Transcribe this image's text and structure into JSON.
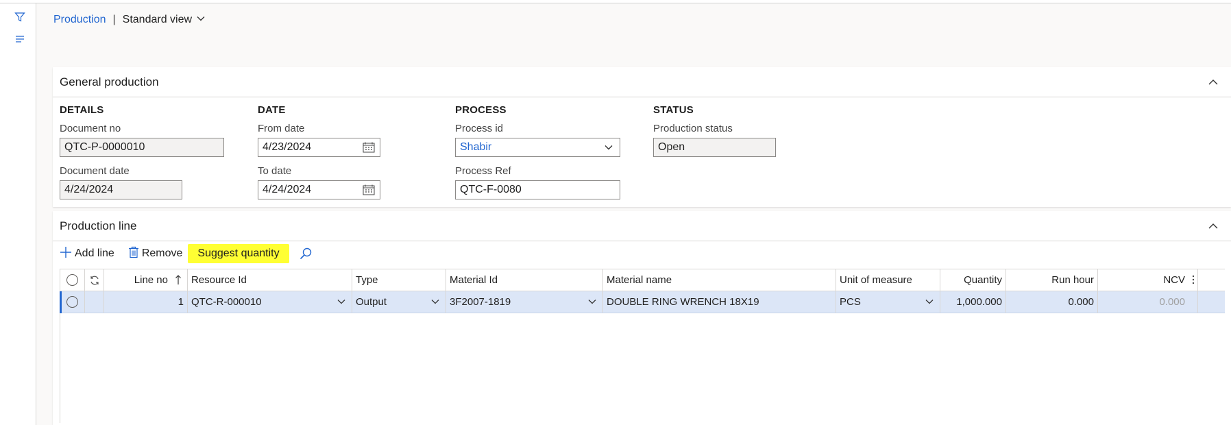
{
  "breadcrumb": {
    "module": "Production",
    "separator": "|",
    "view": "Standard view"
  },
  "general": {
    "title": "General production",
    "details": {
      "heading": "DETAILS",
      "document_no_label": "Document no",
      "document_no": "QTC-P-0000010",
      "document_date_label": "Document date",
      "document_date": "4/24/2024"
    },
    "date": {
      "heading": "DATE",
      "from_label": "From date",
      "from": "4/23/2024",
      "to_label": "To date",
      "to": "4/24/2024"
    },
    "process": {
      "heading": "PROCESS",
      "process_id_label": "Process id",
      "process_id": "Shabir",
      "process_ref_label": "Process Ref",
      "process_ref": "QTC-F-0080"
    },
    "status": {
      "heading": "STATUS",
      "production_status_label": "Production status",
      "production_status": "Open"
    }
  },
  "lines": {
    "title": "Production line",
    "toolbar": {
      "add_line": "Add line",
      "remove": "Remove",
      "suggest_quantity": "Suggest quantity"
    },
    "columns": {
      "line_no": "Line no",
      "resource_id": "Resource Id",
      "type": "Type",
      "material_id": "Material Id",
      "material_name": "Material name",
      "unit": "Unit of measure",
      "quantity": "Quantity",
      "run_hour": "Run hour",
      "ncv": "NCV"
    },
    "rows": [
      {
        "line_no": "1",
        "resource_id": "QTC-R-000010",
        "type": "Output",
        "material_id": "3F2007-1819",
        "material_name": "DOUBLE RING WRENCH 18X19",
        "unit": "PCS",
        "quantity": "1,000.000",
        "run_hour": "0.000",
        "ncv": "0.000"
      }
    ]
  },
  "colors": {
    "link": "#2266d0",
    "highlight": "#ffff33",
    "selected_row": "#dce6f7"
  },
  "icons": [
    "filter-icon",
    "list-icon",
    "chevron-down-icon",
    "chevron-up-icon",
    "calendar-icon",
    "plus-icon",
    "trash-icon",
    "search-icon",
    "refresh-icon",
    "sort-up-icon",
    "more-vertical-icon"
  ]
}
